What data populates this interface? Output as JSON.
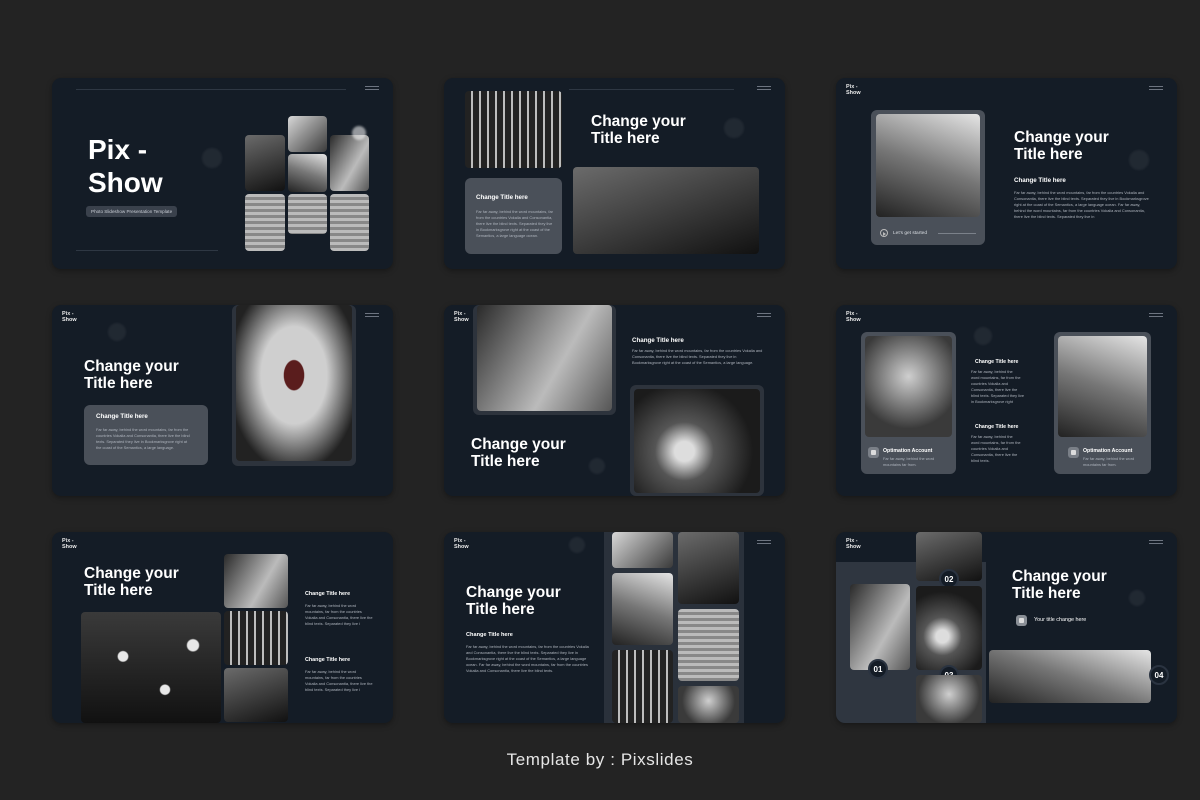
{
  "caption": "Template by : Pixslides",
  "brand": {
    "logo": "Pix -\nShow"
  },
  "slide1": {
    "title_l1": "Pix -",
    "title_l2": "Show",
    "subtitle": "Photo Slideshow Presentation Template"
  },
  "slide2": {
    "title_l1": "Change your",
    "title_l2": "Title here",
    "card_heading": "Change Title here",
    "card_text": "Far far away, behind the word mountains, far\nfrom the countries Vokalia and Consonantia,\nthere live the blind texts. Separated they live\nin Bookmarksgrove right at the coast of the\nSemantics, a large language ocean."
  },
  "slide3": {
    "title_l1": "Change your",
    "title_l2": "Title here",
    "heading": "Change Title here",
    "text": "Far far away, behind the word mountains, far from the countries Vokalia and\nConsonantia, there live the blind texts. Separated they live in Bookmarksgrove\nright at the coast of the Semantics, a large language ocean. Far far away,\nbehind the word mountains, far from the countries Vokalia and Consonantia,\nthere live the blind texts. Separated they live in",
    "button": "Let's get started"
  },
  "slide4": {
    "title_l1": "Change your",
    "title_l2": "Title here",
    "card_heading": "Change Title here",
    "card_text": "Far far away, behind the word mountains, far from the\ncountries Vokalia and Consonantia, there live the blind\ntexts. Separated they live in Bookmarksgrove right at\nthe coast of the Semantics, a large language."
  },
  "slide5": {
    "title_l1": "Change your",
    "title_l2": "Title here",
    "heading": "Change Title here",
    "text": "Far far away, behind the word mountains, far from the countries Vokalia and\nConsonantia, there live the blind texts. Separated they live in\nBookmarksgrove right at the coast of the Semantics, a large language."
  },
  "slide6": {
    "heading_a": "Change Title here",
    "text_a": "Far far away, behind the\nword mountains, far from the\ncountries Vokalia and\nConsonantia, there live the\nblind texts. Separated they live\nin Bookmarksgrove right",
    "heading_b": "Change Title here",
    "text_b": "Far far away, behind the\nword mountains, far from the\ncountries Vokalia and\nConsonantia, there live the\nblind texts.",
    "card_a_title": "Optimation Account",
    "card_a_text": "Far far away, behind the word\nmountains far from.",
    "card_b_title": "Optimation Account",
    "card_b_text": "Far far away, behind the word\nmountains far from."
  },
  "slide7": {
    "title_l1": "Change your",
    "title_l2": "Title here",
    "heading_a": "Change Title here",
    "text_a": "Far far away, behind the word\nmountains, far from the countries\nVokalia and Consonantia, there live the\nblind texts. Separated they live i",
    "heading_b": "Change Title here",
    "text_b": "Far far away, behind the word\nmountains, far from the countries\nVokalia and Consonantia, there live the\nblind texts. Separated they live i"
  },
  "slide8": {
    "title_l1": "Change your",
    "title_l2": "Title here",
    "heading": "Change Title here",
    "text": "Far far away, behind the word mountains, far from the countries Vokalia\nand Consonantia, there live the blind texts. Separated they live in\nBookmarksgrove right at the coast of the Semantics, a large language\nocean. Far far away, behind the word mountains, far from the countries\nVokalia and Consonantia, there live the blind texts."
  },
  "slide9": {
    "title_l1": "Change your",
    "title_l2": "Title here",
    "link": "Your title change here",
    "n1": "01",
    "n2": "02",
    "n3": "03",
    "n4": "04"
  }
}
